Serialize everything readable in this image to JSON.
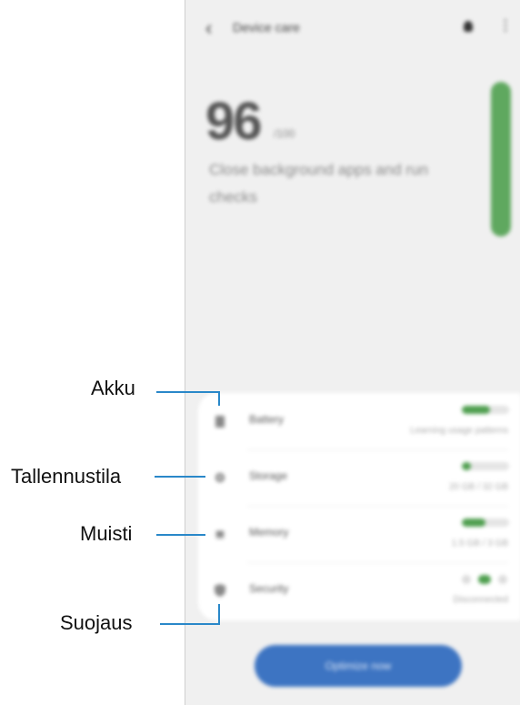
{
  "screen": {
    "app_title": "Device care",
    "score": "96",
    "score_unit": "/100",
    "tip": "Close background apps and run checks",
    "gauge_level": 0.96,
    "rows": [
      {
        "label": "Battery",
        "sub": "Learning usage patterns",
        "level": 0.6
      },
      {
        "label": "Storage",
        "sub": "20 GB / 32 GB",
        "level": 0.2
      },
      {
        "label": "Memory",
        "sub": "1.5 GB / 3 GB",
        "level": 0.5
      },
      {
        "label": "Security",
        "sub": "Disconnected",
        "level": null
      }
    ],
    "optimize_label": "Optimize now"
  },
  "callouts": {
    "battery": "Akku",
    "storage": "Tallennustila",
    "memory": "Muisti",
    "security": "Suojaus"
  },
  "colors": {
    "accent": "#3d74c2",
    "status_green": "#5fa85f",
    "callout_line": "#2a88c9"
  },
  "icons": [
    "back-arrow-icon",
    "bulb-icon",
    "more-options-icon",
    "battery-icon",
    "storage-icon",
    "memory-icon",
    "shield-icon"
  ]
}
